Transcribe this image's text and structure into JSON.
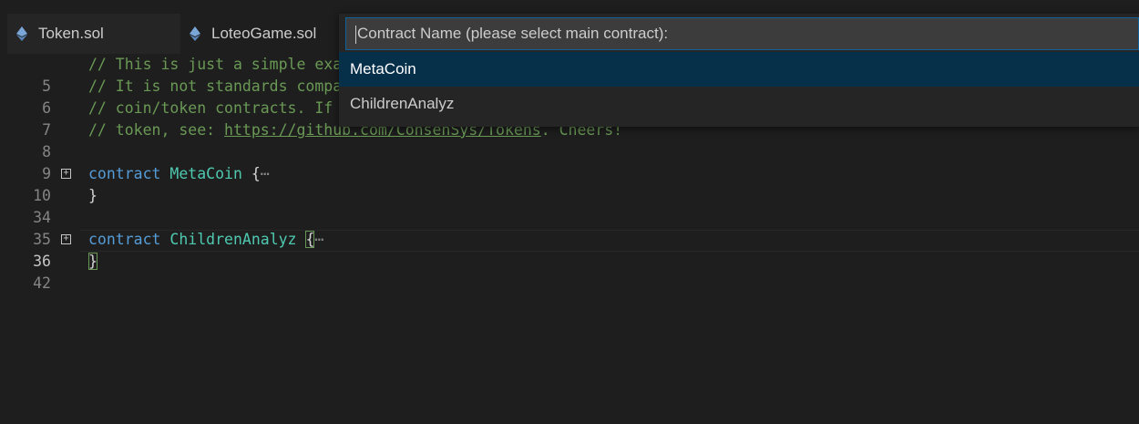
{
  "tabs": [
    {
      "label": "Token.sol",
      "icon": "ethereum-icon",
      "active": false
    },
    {
      "label": "LoteoGame.sol",
      "icon": "ethereum-icon",
      "active": true
    }
  ],
  "quick_pick": {
    "input_value": "",
    "placeholder": "Contract Name (please select main contract):",
    "items": [
      {
        "label": "MetaCoin",
        "selected": true
      },
      {
        "label": "ChildrenAnalyz",
        "selected": false
      }
    ]
  },
  "editor": {
    "lines": [
      {
        "number": "5",
        "comment": "// This is just a simple example of a coin-like contract."
      },
      {
        "number": "6",
        "comment": "// It is not standards compatible and cannot be expected to talk to other"
      },
      {
        "number": "7",
        "comment": "// coin/token contracts. If you want to create a standards-compliant"
      },
      {
        "number": "8",
        "comment_prefix": "// token, see: ",
        "url": "https://github.com/ConsenSys/Tokens",
        "comment_suffix": ". Cheers!"
      },
      {
        "number": "9"
      },
      {
        "number": "10",
        "keyword": "contract",
        "name": "MetaCoin",
        "brace": "{",
        "ellipsis": "⋯"
      },
      {
        "number": "34",
        "brace": "}"
      },
      {
        "number": "35"
      },
      {
        "number": "36",
        "keyword": "contract",
        "name": "ChildrenAnalyz",
        "brace": "{",
        "ellipsis": "⋯"
      },
      {
        "number": "42",
        "brace": "}"
      }
    ]
  },
  "colors": {
    "comment": "#6a9955",
    "keyword": "#569cd6",
    "type_name": "#4ec9b0",
    "selection": "#062f4a",
    "input_border": "#0e639c"
  }
}
